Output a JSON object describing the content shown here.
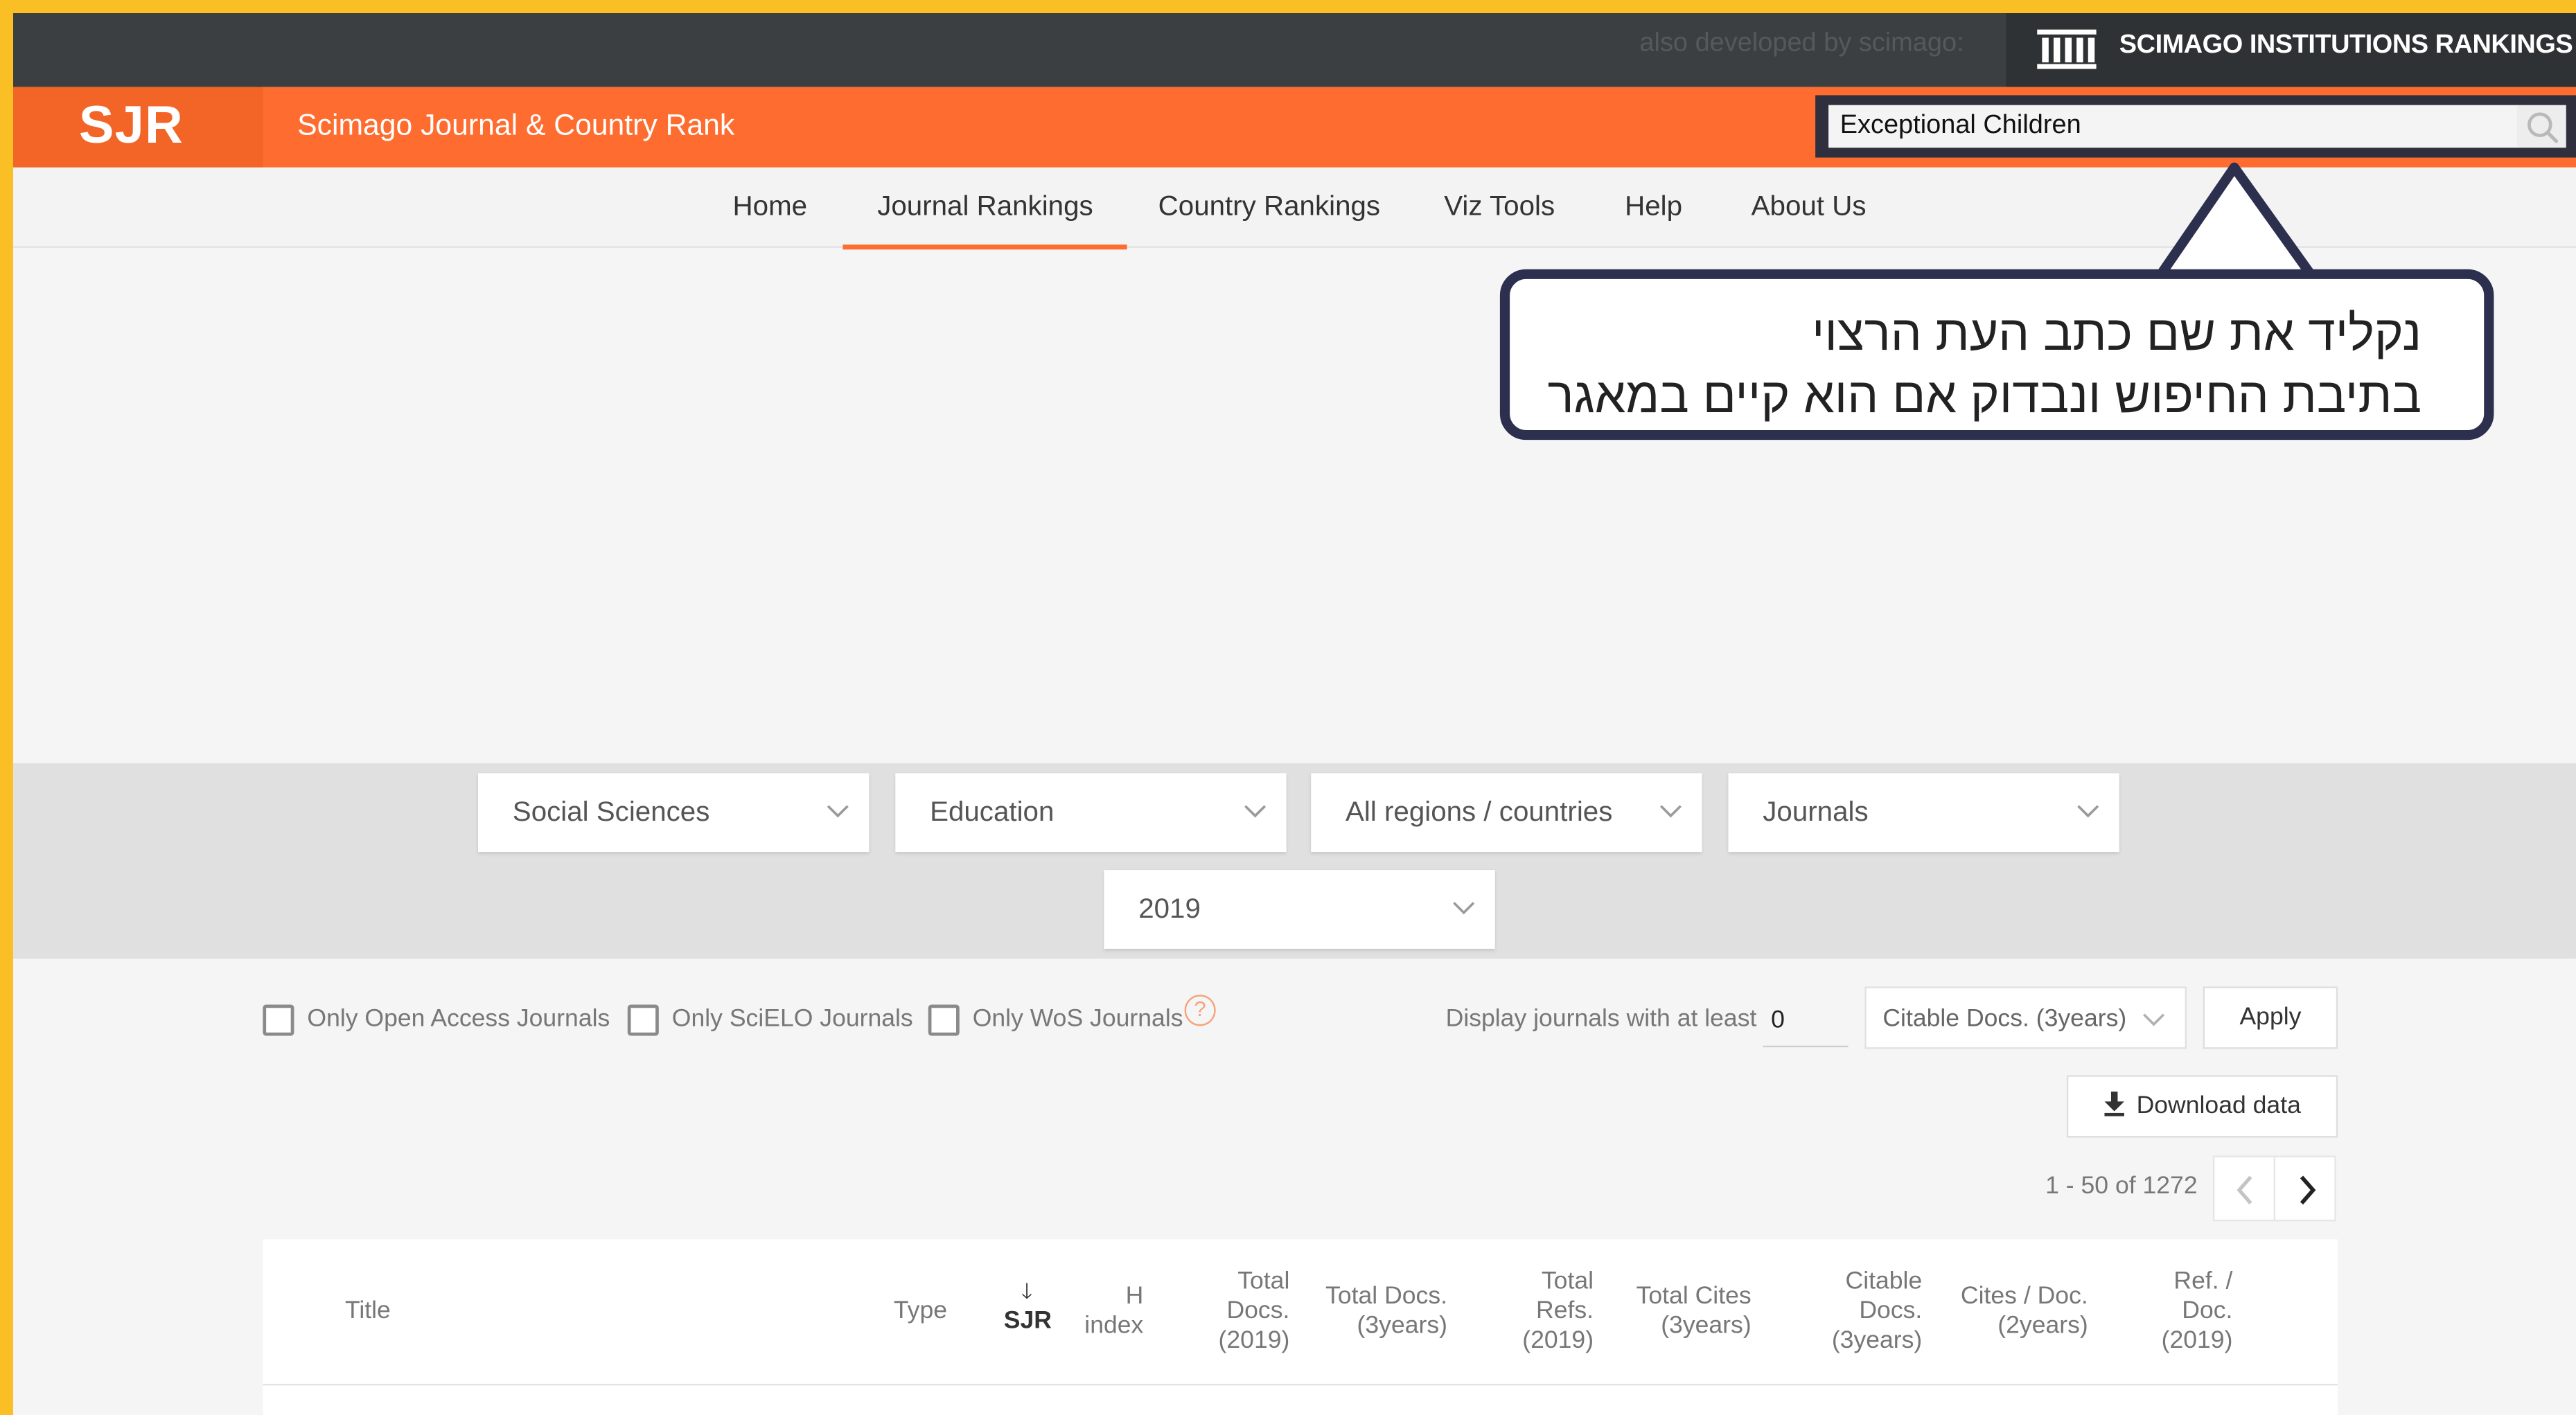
{
  "topbar": {
    "also_text": "also developed by scimago:",
    "sir_label": "SCIMAGO INSTITUTIONS RANKINGS",
    "sir_icon": "columns-building-icon"
  },
  "header": {
    "logo": "SJR",
    "site_title": "Scimago Journal & Country Rank",
    "search_value": "Exceptional Children",
    "search_icon": "search-icon"
  },
  "nav": {
    "items": [
      "Home",
      "Journal Rankings",
      "Country Rankings",
      "Viz Tools",
      "Help",
      "About Us"
    ],
    "active": "Journal Rankings"
  },
  "callout": {
    "line1": "נקליד את שם כתב העת הרצוי",
    "line2": "בתיבת החיפוש ונבדוק אם הוא קיים במאגר"
  },
  "filters": {
    "subject_area": "Social Sciences",
    "subject_category": "Education",
    "region": "All regions / countries",
    "type": "Journals",
    "year": "2019"
  },
  "options": {
    "open_access": "Only Open Access Journals",
    "scielo": "Only SciELO Journals",
    "wos": "Only WoS Journals",
    "help_glyph": "?",
    "display_at_least": "Display journals with at least",
    "min_value": "0",
    "citable_select": "Citable Docs. (3years)",
    "apply": "Apply",
    "download": "Download data"
  },
  "pagination": {
    "range": "1 - 50 of 1272"
  },
  "table": {
    "columns": {
      "title": "Title",
      "type": "Type",
      "sort_arrow": "🡓",
      "sjr": "SJR",
      "h1": "H",
      "h2": "index",
      "td1": "Total",
      "td2": "Docs.",
      "td3": "(2019)",
      "td3y1": "Total Docs.",
      "td3y2": "(3years)",
      "tr1": "Total",
      "tr2": "Refs.",
      "tr3": "(2019)",
      "tc1": "Total Cites",
      "tc2": "(3years)",
      "cd1": "Citable",
      "cd2": "Docs.",
      "cd3": "(3years)",
      "cpd1": "Cites / Doc.",
      "cpd2": "(2years)",
      "rpd1": "Ref. /",
      "rpd2": "Doc.",
      "rpd3": "(2019)"
    }
  },
  "colors": {
    "accent": "#fe6d2f",
    "topbar": "#3c3f42",
    "callout_border": "#2d2f4f",
    "outer_frame": "#fbbf26"
  }
}
